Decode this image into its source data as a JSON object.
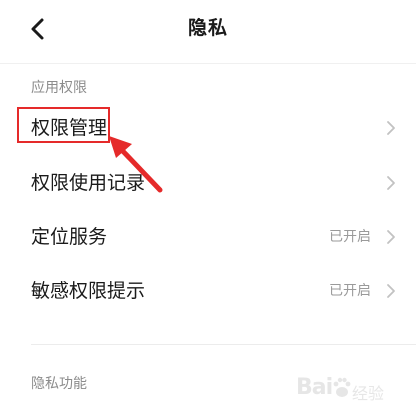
{
  "header": {
    "title": "隐私",
    "back_icon": "chevron-left-icon"
  },
  "sections": [
    {
      "label": "应用权限",
      "items": [
        {
          "label": "权限管理",
          "value": ""
        },
        {
          "label": "权限使用记录",
          "value": ""
        },
        {
          "label": "定位服务",
          "value": "已开启"
        },
        {
          "label": "敏感权限提示",
          "value": "已开启"
        }
      ]
    },
    {
      "label": "隐私功能",
      "items": []
    }
  ],
  "annotation": {
    "highlight_color": "#e52a2a",
    "highlighted_item": "权限管理"
  },
  "watermark": {
    "text": "Bai",
    "sub": "经验"
  },
  "colors": {
    "text_primary": "#1a1a1a",
    "text_secondary": "#8c8c8c",
    "chevron": "#c2c2c2",
    "accent_red": "#e52a2a"
  }
}
